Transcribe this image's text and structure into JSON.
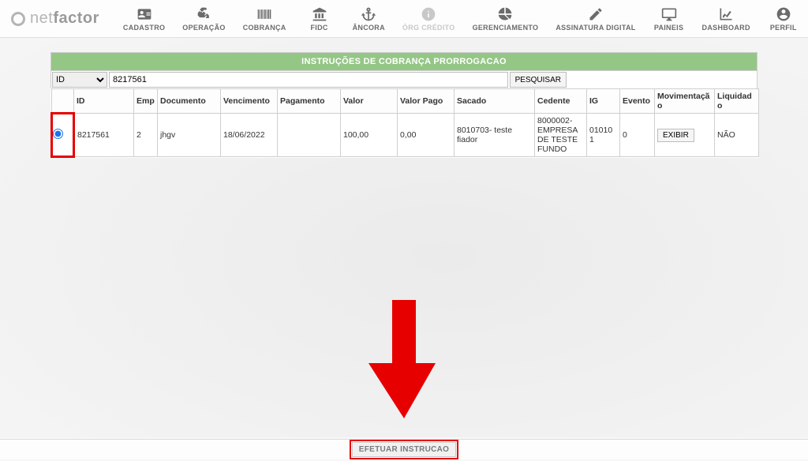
{
  "logo": {
    "part1": "net",
    "part2": "factor"
  },
  "nav": {
    "cadastro": "CADASTRO",
    "operacao": "OPERAÇÃO",
    "cobranca": "COBRANÇA",
    "fidc": "FIDC",
    "ancora": "ÂNCORA",
    "orgcredito": "ÓRG CRÉDITO",
    "gerenciamento": "GERENCIAMENTO",
    "assinatura": "ASSINATURA DIGITAL",
    "paineis": "PAINEIS",
    "dashboard": "DASHBOARD",
    "perfil": "PERFIL"
  },
  "panel": {
    "title": "INSTRUÇÕES DE COBRANÇA PRORROGACAO"
  },
  "search": {
    "field_option": "ID",
    "value": "8217561",
    "button": "PESQUISAR"
  },
  "columns": {
    "select": "",
    "id": "ID",
    "emp": "Emp",
    "documento": "Documento",
    "vencimento": "Vencimento",
    "pagamento": "Pagamento",
    "valor": "Valor",
    "valorpago": "Valor Pago",
    "sacado": "Sacado",
    "cedente": "Cedente",
    "ig": "IG",
    "evento": "Evento",
    "movimentacao": "Movimentação",
    "liquidado": "Liquidado"
  },
  "row": {
    "id": "8217561",
    "emp": "2",
    "documento": "jhgv",
    "vencimento": "18/06/2022",
    "pagamento": "",
    "valor": "100,00",
    "valorpago": "0,00",
    "sacado": "8010703- teste fiador",
    "cedente": "8000002- EMPRESA DE TESTE FUNDO",
    "ig": "010101",
    "evento": "0",
    "mov_button": "EXIBIR",
    "liquidado": "NÃO"
  },
  "footer": {
    "button": "EFETUAR INSTRUCAO"
  }
}
